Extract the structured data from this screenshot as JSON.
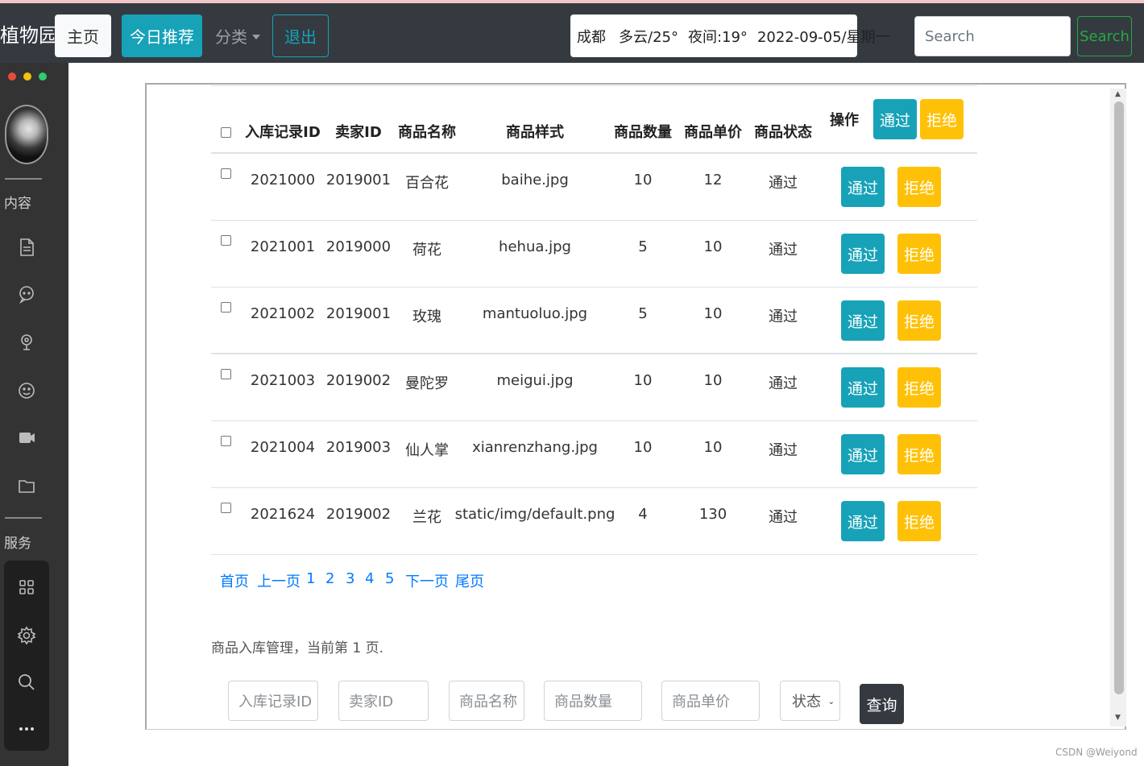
{
  "nav": {
    "brand": "植物园",
    "home": "主页",
    "today": "今日推荐",
    "category": "分类",
    "logout": "退出",
    "search_placeholder": "Search",
    "search_button": "Search"
  },
  "weather": {
    "city": "成都",
    "day": "多云/25°",
    "night": "夜间:19°",
    "date": "2022-09-05/星期一"
  },
  "sidebar": {
    "section_content": "内容",
    "section_service": "服务",
    "dots": [
      "#e74c3c",
      "#f1c40f",
      "#2ecc71"
    ]
  },
  "table": {
    "headers": [
      "入库记录ID",
      "卖家ID",
      "商品名称",
      "商品样式",
      "商品数量",
      "商品单价",
      "商品状态",
      "操作"
    ],
    "header_pass": "通过",
    "header_reject": "拒绝",
    "pass_label": "通过",
    "reject_label": "拒绝",
    "rows": [
      {
        "id": "2021000",
        "seller": "2019001",
        "name": "百合花",
        "style": "baihe.jpg",
        "qty": "10",
        "price": "12",
        "status": "通过"
      },
      {
        "id": "2021001",
        "seller": "2019000",
        "name": "荷花",
        "style": "hehua.jpg",
        "qty": "5",
        "price": "10",
        "status": "通过"
      },
      {
        "id": "2021002",
        "seller": "2019001",
        "name": "玫瑰",
        "style": "mantuoluo.jpg",
        "qty": "5",
        "price": "10",
        "status": "通过"
      },
      {
        "id": "2021003",
        "seller": "2019002",
        "name": "曼陀罗",
        "style": "meigui.jpg",
        "qty": "10",
        "price": "10",
        "status": "通过"
      },
      {
        "id": "2021004",
        "seller": "2019003",
        "name": "仙人掌",
        "style": "xianrenzhang.jpg",
        "qty": "10",
        "price": "10",
        "status": "通过"
      },
      {
        "id": "2021624",
        "seller": "2019002",
        "name": "兰花",
        "style": "static/img/default.png",
        "qty": "4",
        "price": "130",
        "status": "通过"
      }
    ]
  },
  "pager": {
    "first": "首页",
    "prev": "上一页",
    "pages": [
      "1",
      "2",
      "3",
      "4",
      "5"
    ],
    "next": "下一页",
    "last": "尾页"
  },
  "status_text": "商品入库管理，当前第 1 页.",
  "filters": {
    "record_id": "入库记录ID",
    "seller_id": "卖家ID",
    "name": "商品名称",
    "qty": "商品数量",
    "price": "商品单价",
    "status": "状态",
    "query": "查询"
  },
  "watermark": "CSDN @Weiyond"
}
